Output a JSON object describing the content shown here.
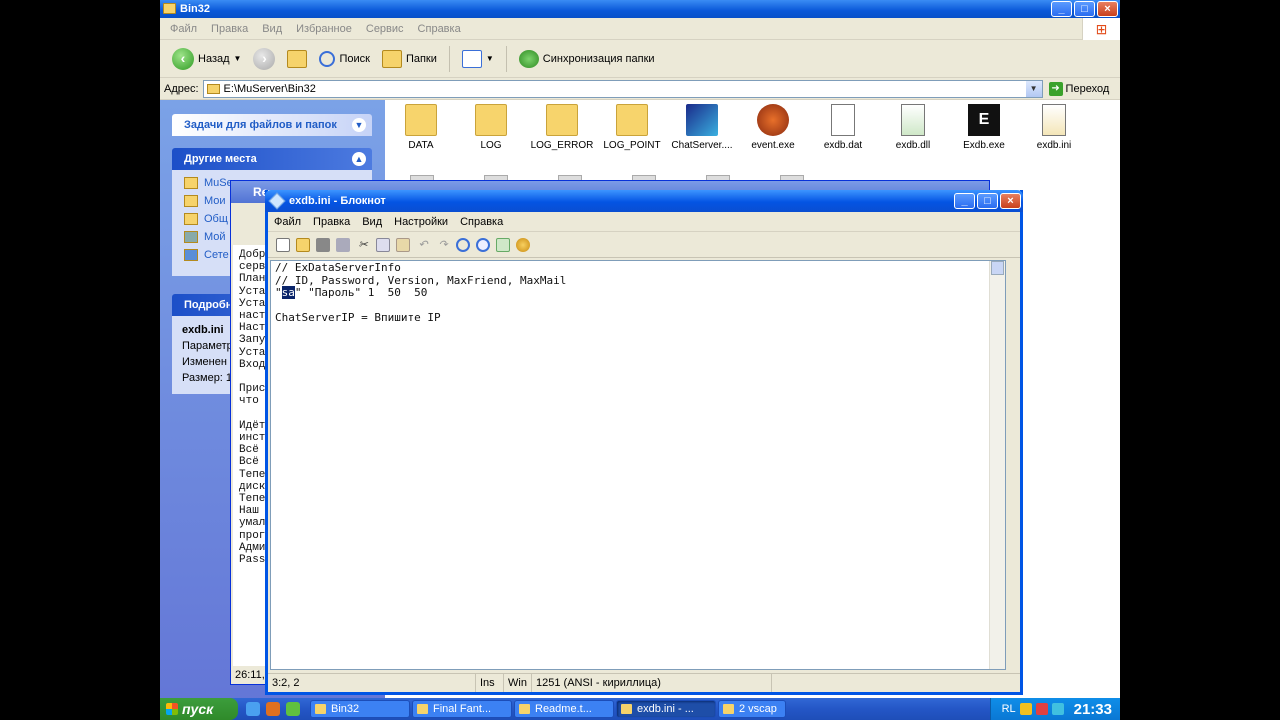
{
  "explorer": {
    "title": "Bin32",
    "menu": [
      "Файл",
      "Правка",
      "Вид",
      "Избранное",
      "Сервис",
      "Справка"
    ],
    "toolbar": {
      "back": "Назад",
      "search": "Поиск",
      "folders": "Папки",
      "sync": "Синхронизация папки"
    },
    "address_label": "Адрес:",
    "address_value": "E:\\MuServer\\Bin32",
    "go_label": "Переход",
    "tasks_header": "Задачи для файлов и папок",
    "other_places_header": "Другие места",
    "other_places": [
      "MuSe",
      "Мои",
      "Общ",
      "Мой",
      "Сете"
    ],
    "details_header": "Подробн",
    "details": {
      "name": "exdb.ini",
      "type": "Параметр",
      "modified": "Изменен",
      "size": "Размер: 1"
    },
    "files": [
      "DATA",
      "LOG",
      "LOG_ERROR",
      "LOG_POINT",
      "ChatServer....",
      "event.exe",
      "exdb.dat",
      "exdb.dll",
      "Exdb.exe",
      "exdb.ini"
    ]
  },
  "readme": {
    "title": "Re",
    "text_lines": [
      "Добр",
      "серв",
      "План",
      "Уста",
      "Уста",
      "наст",
      "Наст",
      "Запу",
      "Уста",
      "Вход",
      "",
      "Прис",
      "что",
      "",
      "Идёт",
      "инст",
      "Всё",
      "Всё",
      "Тепе",
      "диск",
      "Тепе",
      "Наш",
      "умал",
      "прог",
      "Адми",
      "Pass"
    ],
    "status": "26:11,"
  },
  "notepad": {
    "title": "exdb.ini - Блокнот",
    "menu": [
      "Файл",
      "Правка",
      "Вид",
      "Настройки",
      "Справка"
    ],
    "line1": "// ExDataServerInfo",
    "line2": "// ID, Password, Version, MaxFriend, MaxMail",
    "line3_pre": "\"",
    "line3_sel": "sa",
    "line3_post": "\" \"Пароль\" 1  50  50",
    "line4": "",
    "line5": "ChatServerIP = Впишите IP",
    "status_pos": "3:2, 2",
    "status_ins": "Ins",
    "status_win": "Win",
    "status_enc": "1251  (ANSI - кириллица)"
  },
  "taskbar": {
    "start": "пуск",
    "tasks": [
      "Bin32",
      "Final Fant...",
      "Readme.t...",
      "exdb.ini - ...",
      "2 vscap"
    ],
    "active_task_index": 3,
    "lang": "RL",
    "clock": "21:33"
  }
}
